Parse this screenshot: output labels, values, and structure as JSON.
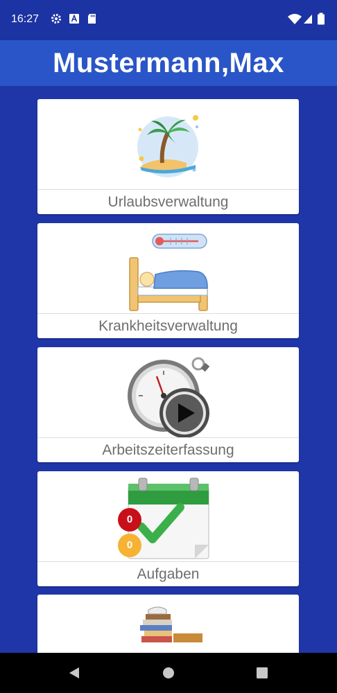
{
  "status_bar": {
    "time": "16:27"
  },
  "app_bar": {
    "title": "Mustermann,Max"
  },
  "menu": [
    {
      "label": "Urlaubsverwaltung",
      "icon": "vacation-island-icon"
    },
    {
      "label": "Krankheitsverwaltung",
      "icon": "sick-bed-icon"
    },
    {
      "label": "Arbeitszeiterfassung",
      "icon": "stopwatch-play-icon"
    },
    {
      "label": "Aufgaben",
      "icon": "calendar-check-icon",
      "badges": {
        "red": "0",
        "orange": "0"
      }
    },
    {
      "label": "",
      "icon": "books-stack-icon"
    }
  ],
  "colors": {
    "primary_dark": "#1c33a3",
    "primary": "#2a55c8",
    "background": "#1f36a8",
    "badge_red": "#c8101a",
    "badge_orange": "#f5b233"
  }
}
